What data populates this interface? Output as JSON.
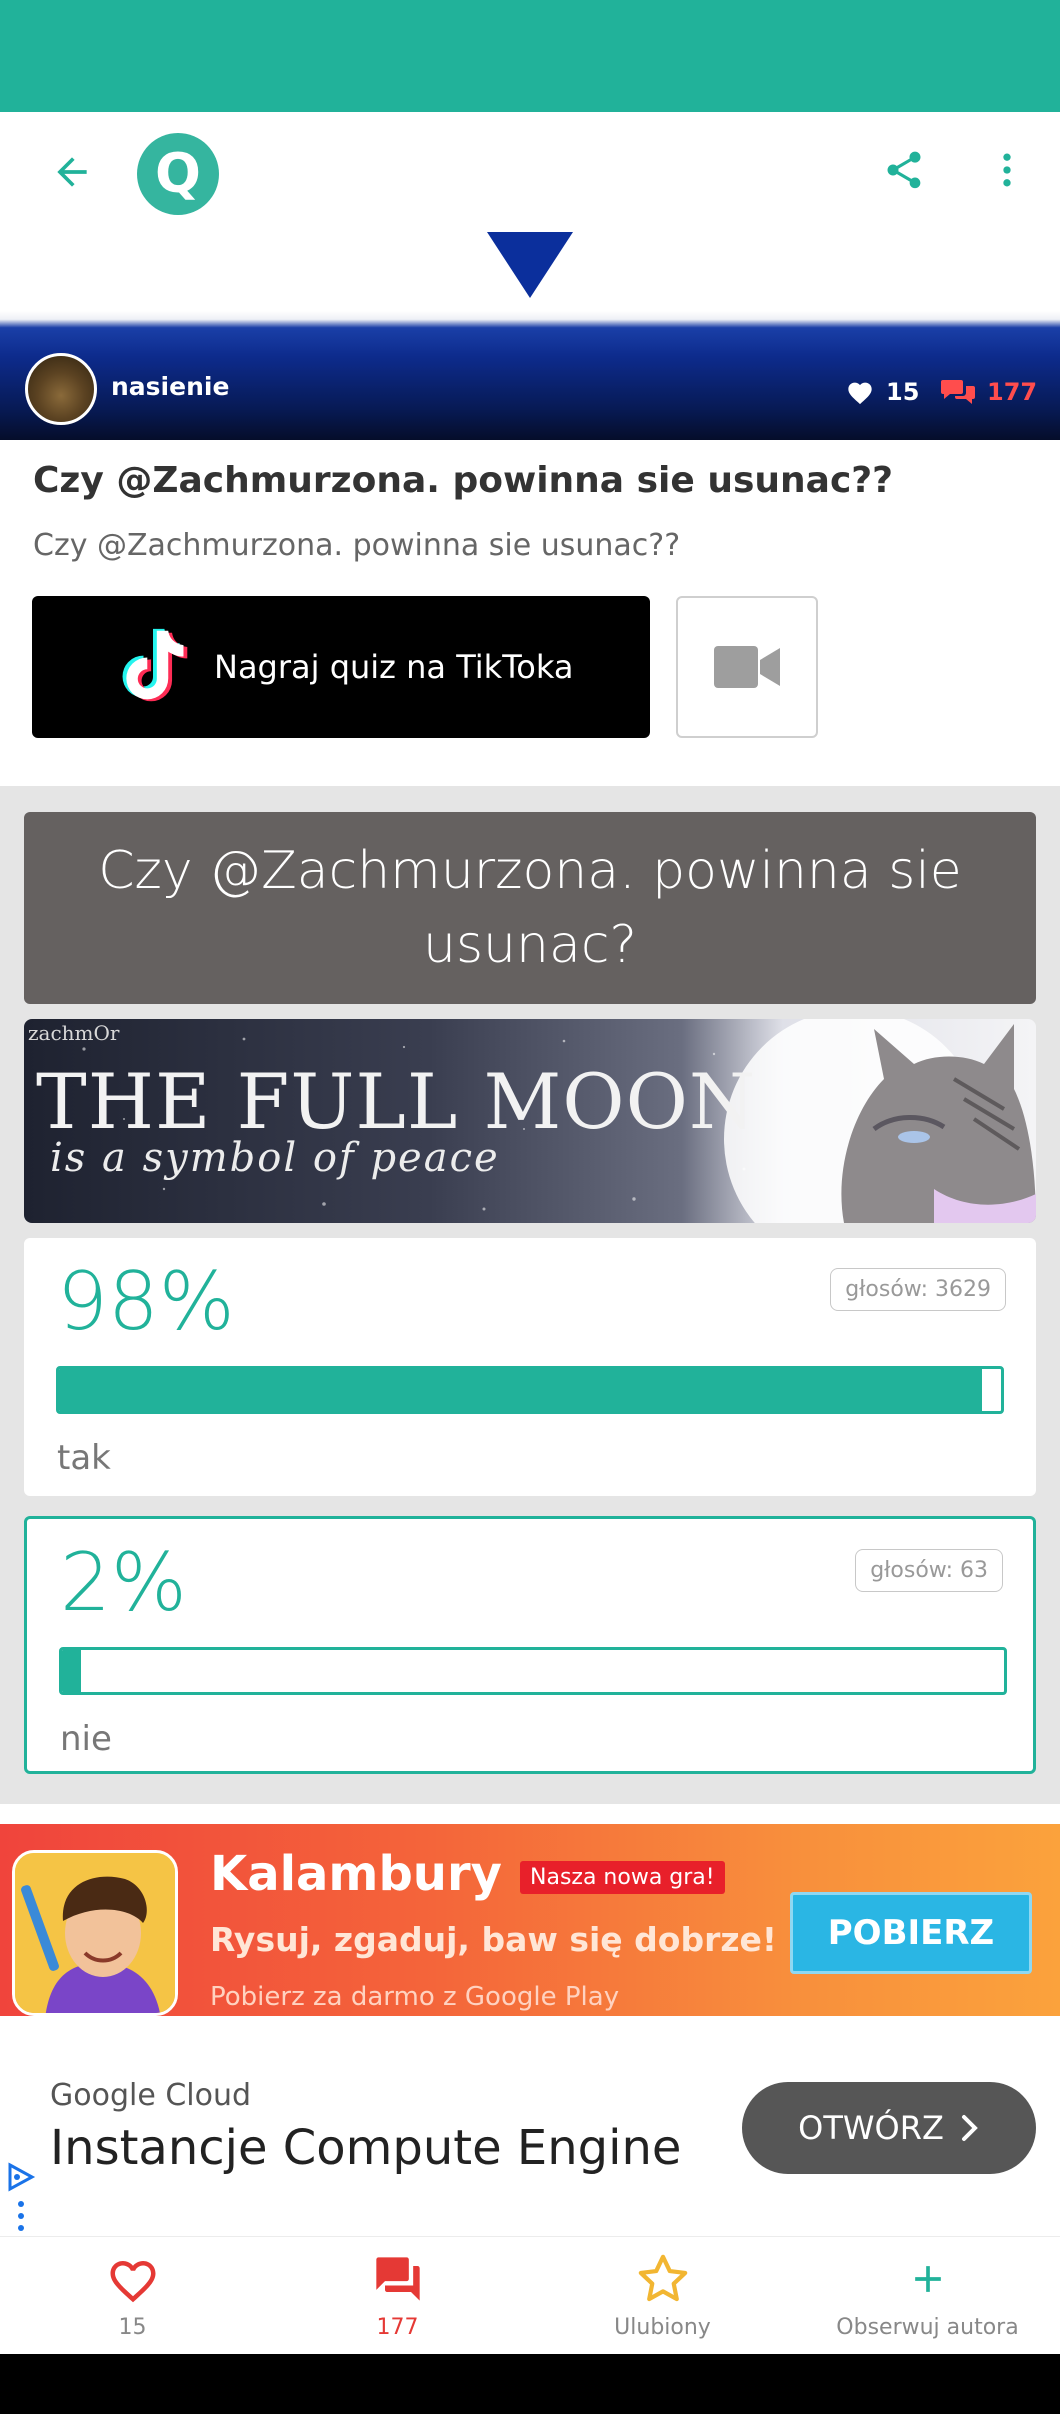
{
  "app_bar": {
    "logo_letter": "Q"
  },
  "author": {
    "name": "nasienie",
    "likes": "15",
    "comments": "177"
  },
  "quiz": {
    "title": "Czy @Zachmurzona. powinna sie usunac??",
    "description": "Czy @Zachmurzona. powinna sie usunac??",
    "tiktok_button_label": "Nagraj quiz na TikToka"
  },
  "question": {
    "text": "Czy @Zachmurzona. powinna sie usunac?",
    "image_title": "THE FULL MOON",
    "image_subtitle": "is a symbol of peace",
    "image_watermark": "zachmOr"
  },
  "options": [
    {
      "percent_label": "98%",
      "fill_fraction": 0.98,
      "votes_label": "głosów: 3629",
      "label": "tak",
      "selected": false
    },
    {
      "percent_label": "2%",
      "fill_fraction": 0.02,
      "votes_label": "głosów: 63",
      "label": "nie",
      "selected": true
    }
  ],
  "ad_kalambury": {
    "title": "Kalambury",
    "badge": "Nasza nowa gra!",
    "subtitle": "Rysuj, zgaduj, baw się dobrze!",
    "small": "Pobierz za darmo z Google Play",
    "button": "POBIERZ"
  },
  "ad_google": {
    "provider": "Google Cloud",
    "title": "Instancje Compute Engine",
    "button": "OTWÓRZ"
  },
  "bottom_nav": {
    "likes": "15",
    "comments": "177",
    "favorite": "Ulubiony",
    "follow": "Obserwuj autora"
  },
  "colors": {
    "accent": "#21b29a",
    "question_bg": "#656160",
    "comments_red": "#e53935",
    "kalambury_button": "#2ab6e4"
  },
  "icons": {
    "back": "arrow-left-icon",
    "share": "share-icon",
    "more": "more-vert-icon",
    "heart": "heart-icon",
    "comments": "chat-bubbles-icon",
    "video": "video-camera-icon",
    "star": "star-icon",
    "plus": "plus-icon",
    "chevron": "chevron-right-icon"
  }
}
